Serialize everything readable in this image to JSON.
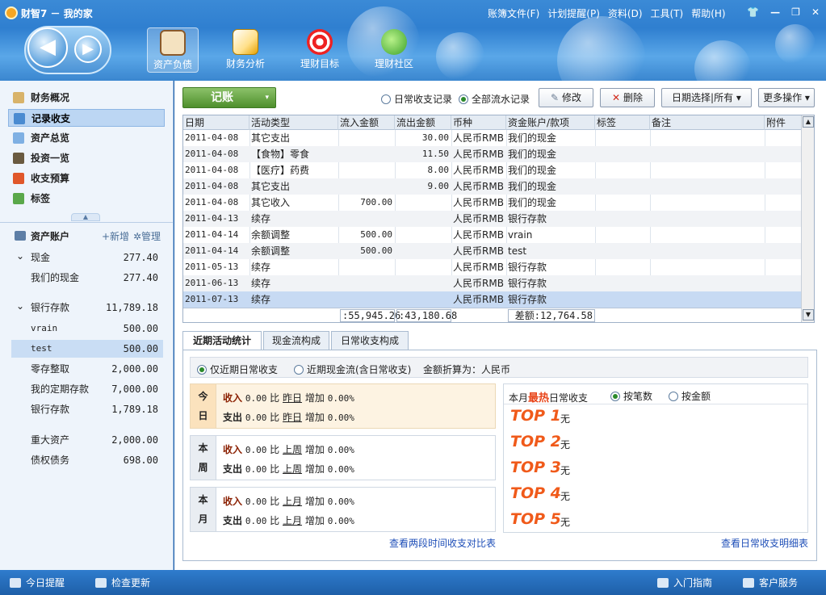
{
  "window": {
    "title": "财智7 － 我的家",
    "menu": [
      "账簿文件(F)",
      "计划提醒(P)",
      "资料(D)",
      "工具(T)",
      "帮助(H)"
    ],
    "controls": [
      "👕",
      "—",
      "❐",
      "✕"
    ]
  },
  "nav": {
    "back_icon": "◀",
    "forward_icon": "▶"
  },
  "modules": [
    {
      "label": "资产负债",
      "icon": "clipboard-icon",
      "active": true
    },
    {
      "label": "财务分析",
      "icon": "chart-icon",
      "active": false
    },
    {
      "label": "理财目标",
      "icon": "target-icon",
      "active": false
    },
    {
      "label": "理财社区",
      "icon": "chat-icon",
      "active": false
    }
  ],
  "sidebar": {
    "nav_items": [
      "财务概况",
      "记录收支",
      "资产总览",
      "投资一览",
      "收支预算",
      "标签"
    ],
    "collapse_glyph": "▲",
    "accounts_title": "资产账户",
    "add_label": "+新增",
    "manage_label": "✲管理",
    "accounts": [
      {
        "name": "现金",
        "amount": "277.40",
        "group": true,
        "expander": "⌄"
      },
      {
        "name": "我们的现金",
        "amount": "277.40"
      },
      {
        "name": "银行存款",
        "amount": "11,789.18",
        "group": true,
        "expander": "⌄"
      },
      {
        "name": "vrain",
        "amount": "500.00"
      },
      {
        "name": "test",
        "amount": "500.00"
      },
      {
        "name": "零存整取",
        "amount": "2,000.00"
      },
      {
        "name": "我的定期存款",
        "amount": "7,000.00"
      },
      {
        "name": "银行存款",
        "amount": "1,789.18"
      },
      {
        "name": "重大资产",
        "amount": "2,000.00"
      },
      {
        "name": "债权债务",
        "amount": "698.00"
      }
    ]
  },
  "toolbar": {
    "jizhang_label": "记账",
    "jizhang_arrow": "▾",
    "radio_daily": "日常收支记录",
    "radio_all": "全部流水记录",
    "edit_label": "修改",
    "delete_label": "删除",
    "date_filter": "日期选择|所有",
    "more_label": "更多操作",
    "dropdown_glyph": "▾"
  },
  "table": {
    "columns": [
      "日期",
      "活动类型",
      "流入金额",
      "流出金额",
      "币种",
      "资金账户/款项",
      "标签",
      "备注",
      "附件"
    ],
    "rows": [
      [
        "2011-04-08",
        "其它支出",
        "",
        "30.00",
        "人民币RMB",
        "我们的现金",
        "",
        "",
        ""
      ],
      [
        "2011-04-08",
        "【食物】零食",
        "",
        "11.50",
        "人民币RMB",
        "我们的现金",
        "",
        "",
        ""
      ],
      [
        "2011-04-08",
        "【医疗】药费",
        "",
        "8.00",
        "人民币RMB",
        "我们的现金",
        "",
        "",
        ""
      ],
      [
        "2011-04-08",
        "其它支出",
        "",
        "9.00",
        "人民币RMB",
        "我们的现金",
        "",
        "",
        ""
      ],
      [
        "2011-04-08",
        "其它收入",
        "700.00",
        "",
        "人民币RMB",
        "我们的现金",
        "",
        "",
        ""
      ],
      [
        "2011-04-13",
        "续存",
        "",
        "",
        "人民币RMB",
        "银行存款",
        "",
        "",
        ""
      ],
      [
        "2011-04-14",
        "余额调整",
        "500.00",
        "",
        "人民币RMB",
        "vrain",
        "",
        "",
        ""
      ],
      [
        "2011-04-14",
        "余额调整",
        "500.00",
        "",
        "人民币RMB",
        "test",
        "",
        "",
        ""
      ],
      [
        "2011-05-13",
        "续存",
        "",
        "",
        "人民币RMB",
        "银行存款",
        "",
        "",
        ""
      ],
      [
        "2011-06-13",
        "续存",
        "",
        "",
        "人民币RMB",
        "银行存款",
        "",
        "",
        ""
      ],
      [
        "2011-07-13",
        "续存",
        "",
        "",
        "人民币RMB",
        "银行存款",
        "",
        "",
        ""
      ]
    ],
    "total_in": ":55,945.26",
    "total_out": ":43,180.68",
    "diff": "差额:12,764.58",
    "scroll_up": "▲",
    "scroll_down": "▼"
  },
  "bottom": {
    "tabs": [
      "近期活动统计",
      "现金流构成",
      "日常收支构成"
    ],
    "opt_daily": "仅近期日常收支",
    "opt_cashflow": "近期现金流(含日常收支)",
    "currency_note": "金额折算为：人民币",
    "stats": [
      {
        "label": [
          "今",
          "日"
        ],
        "compare": "昨日",
        "income_label": "收入",
        "income": "0.00",
        "expense_label": "支出",
        "expense": "0.00",
        "bi": "比",
        "inc_label": "增加",
        "inc_pct": "0.00%",
        "exp_pct": "0.00%"
      },
      {
        "label": [
          "本",
          "周"
        ],
        "compare": "上周",
        "income_label": "收入",
        "income": "0.00",
        "expense_label": "支出",
        "expense": "0.00",
        "bi": "比",
        "inc_label": "增加",
        "inc_pct": "0.00%",
        "exp_pct": "0.00%"
      },
      {
        "label": [
          "本",
          "月"
        ],
        "compare": "上月",
        "income_label": "收入",
        "income": "0.00",
        "expense_label": "支出",
        "expense": "0.00",
        "bi": "比",
        "inc_label": "增加",
        "inc_pct": "0.00%",
        "exp_pct": "0.00%"
      }
    ],
    "top_title_pre": "本月",
    "top_title_hot": "最热",
    "top_title_post": "日常收支",
    "top_by_count": "按笔数",
    "top_by_amount": "按金额",
    "top_items": [
      {
        "rank": "TOP 1",
        "value": "无"
      },
      {
        "rank": "TOP 2",
        "value": "无"
      },
      {
        "rank": "TOP 3",
        "value": "无"
      },
      {
        "rank": "TOP 4",
        "value": "无"
      },
      {
        "rank": "TOP 5",
        "value": "无"
      }
    ],
    "link_compare": "查看两段时间收支对比表",
    "link_detail": "查看日常收支明细表"
  },
  "statusbar": {
    "reminder": "今日提醒",
    "update": "检查更新",
    "guide": "入门指南",
    "service": "客户服务"
  }
}
